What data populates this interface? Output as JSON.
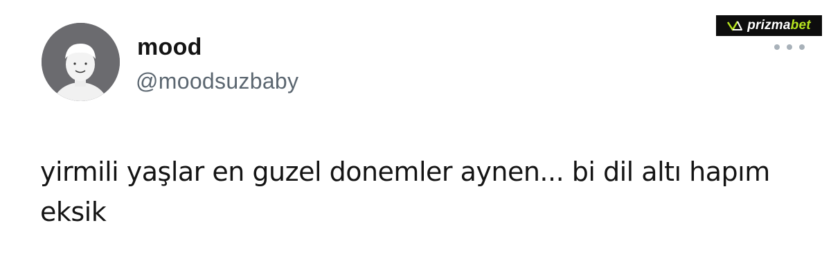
{
  "tweet": {
    "author": {
      "display_name": "mood",
      "handle": "@moodsuzbaby",
      "avatar_icon": "avatar-icon"
    },
    "text_line_1": "yirmili yaşlar en guzel donemler aynen... bi dil altı hapım",
    "text_line_2": "eksik",
    "more_icon": "more-horizontal-icon"
  },
  "watermark": {
    "brand_main": "prizma",
    "brand_accent": "bet",
    "accent_color": "#b7e51f",
    "background_color": "#0d0d0d"
  }
}
